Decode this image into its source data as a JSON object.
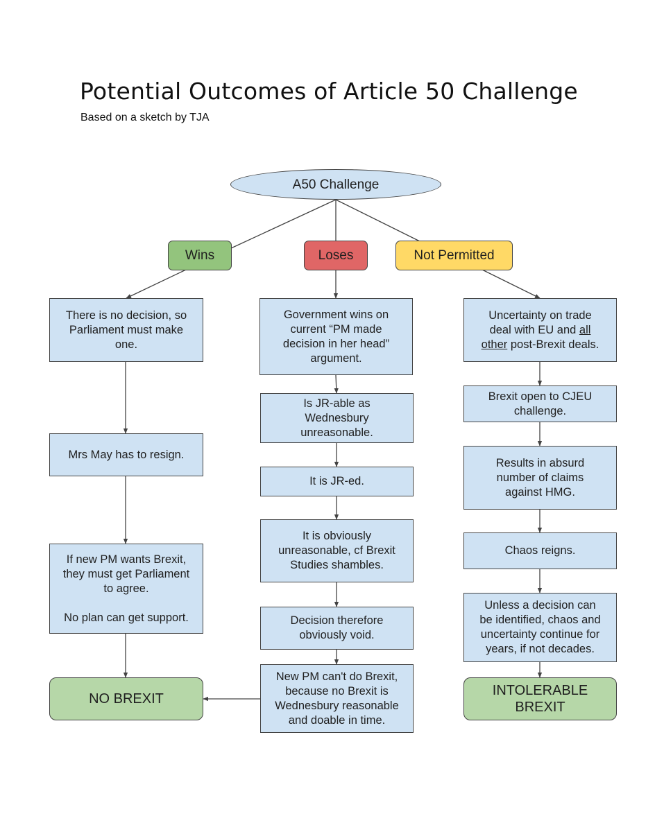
{
  "header": {
    "title": "Potential Outcomes of Article 50 Challenge",
    "subtitle": "Based on a sketch by TJA"
  },
  "colors": {
    "process_fill": "#cfe2f3",
    "wins_fill": "#93c47d",
    "loses_fill": "#e06666",
    "not_permitted_fill": "#ffd966",
    "outcome_fill": "#b6d7a8",
    "stroke": "#434343"
  },
  "root": {
    "label": "A50 Challenge"
  },
  "branches": {
    "wins": {
      "label": "Wins",
      "steps": [
        "There is no decision, so\nParliament must make\none.",
        "Mrs May has to resign.",
        "If new PM wants Brexit,\nthey must get Parliament\nto agree.\n\nNo plan can get support."
      ],
      "outcome": "NO BREXIT"
    },
    "loses": {
      "label": "Loses",
      "steps": [
        "Government wins on\ncurrent “PM made\ndecision in her head”\nargument.",
        "Is JR-able as\nWednesbury\nunreasonable.",
        "It is JR-ed.",
        "It is obviously\nunreasonable, cf Brexit\nStudies shambles.",
        "Decision therefore\nobviously void.",
        "New PM can't do Brexit,\nbecause no Brexit is\nWednesbury reasonable\nand doable in time."
      ],
      "leads_to": "NO BREXIT"
    },
    "not_permitted": {
      "label": "Not Permitted",
      "steps": [
        {
          "line1": "Uncertainty on trade",
          "line2_pre": "deal with EU and ",
          "line2_u": "all",
          "line3_u": "other",
          "line3_post": " post-Brexit deals."
        },
        "Brexit open to CJEU\nchallenge.",
        "Results in absurd\nnumber of claims\nagainst HMG.",
        "Chaos reigns.",
        "Unless a decision can\nbe identified, chaos and\nuncertainty continue for\nyears, if not decades."
      ],
      "outcome": "INTOLERABLE\nBREXIT"
    }
  }
}
